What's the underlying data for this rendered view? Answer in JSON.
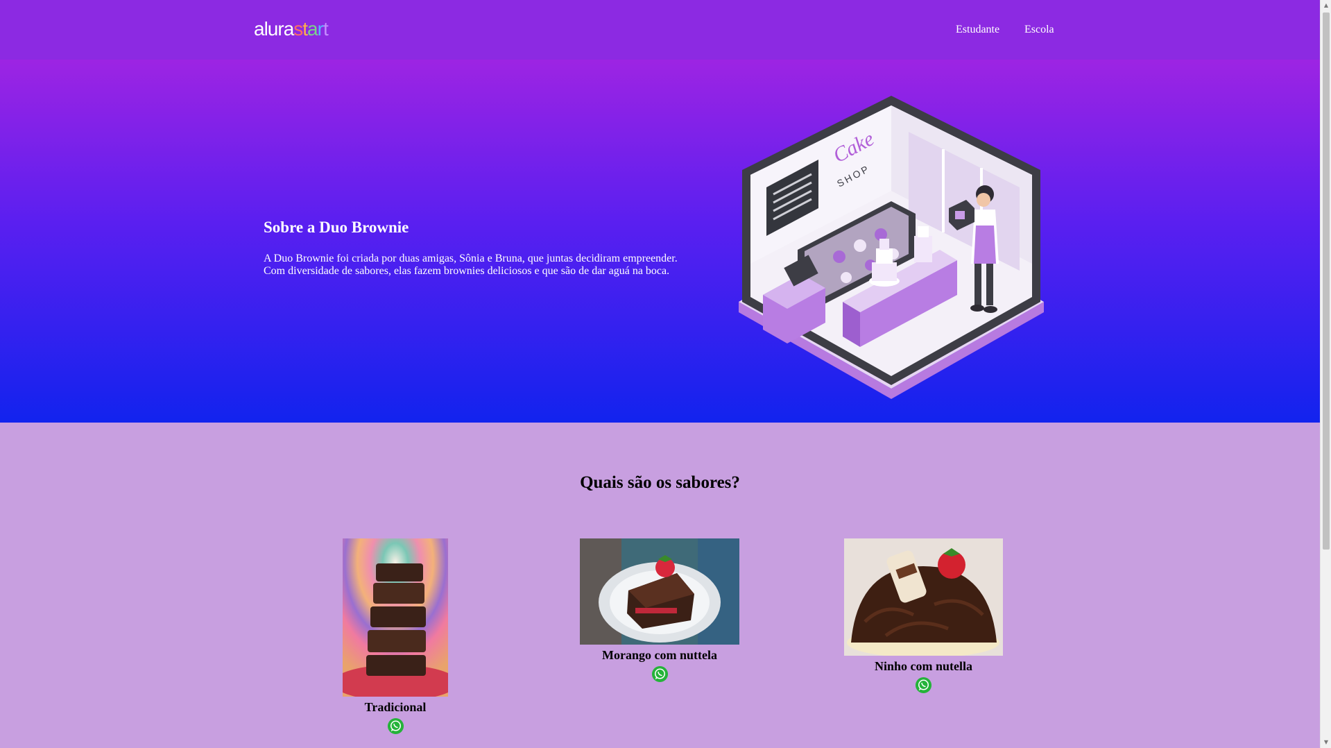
{
  "header": {
    "logo_part1": "alura",
    "logo_part2": "start",
    "nav": [
      "Estudante",
      "Escola"
    ]
  },
  "hero": {
    "title": "Sobre a Duo Brownie",
    "text_line1": "A Duo Brownie foi criada por duas amigas, Sônia e Bruna, que juntas decidiram empreender.",
    "text_line2": "Com diversidade de sabores, elas fazem brownies deliciosos e que são de dar aguá na boca.",
    "illustration_sign_line1": "Cake",
    "illustration_sign_line2": "SHOP"
  },
  "flavors": {
    "title": "Quais são os sabores?",
    "items": [
      {
        "name": "Tradicional",
        "icon": "whatsapp-icon"
      },
      {
        "name": "Morango com nuttela",
        "icon": "whatsapp-icon"
      },
      {
        "name": "Ninho com nutella",
        "icon": "whatsapp-icon"
      }
    ]
  },
  "colors": {
    "header_bg": "#8c2ae2",
    "hero_top": "#9d24e3",
    "hero_bottom": "#1223ee",
    "page_bg": "#c89fe0",
    "whatsapp_green": "#25b33a"
  }
}
